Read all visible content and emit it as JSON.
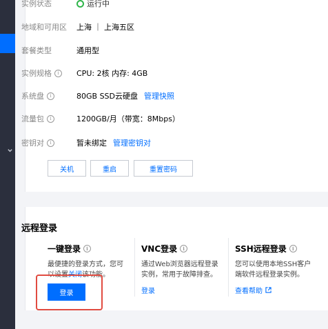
{
  "sidebar": {
    "active_color": "#006eff"
  },
  "instance": {
    "status_label": "实例状态",
    "status_value": "运行中",
    "region_label": "地域和可用区",
    "region_value": "上海 ｜ 上海五区",
    "plan_label": "套餐类型",
    "plan_value": "通用型",
    "spec_label": "实例规格",
    "spec_value": "CPU: 2核 内存: 4GB",
    "disk_label": "系统盘",
    "disk_value": "80GB SSD云硬盘",
    "disk_link": "管理快照",
    "traffic_label": "流量包",
    "traffic_value": "1200GB/月（带宽：8Mbps）",
    "key_label": "密钥对",
    "key_value": "暂未绑定",
    "key_link": "管理密钥对"
  },
  "actions": {
    "shutdown": "关机",
    "restart": "重启",
    "reset_password": "重置密码"
  },
  "remote": {
    "title": "远程登录",
    "one_click": {
      "title": "一键登录",
      "desc_line1": "最便捷的登录方式，您可",
      "desc_prefix": "以设置",
      "desc_link": "关闭",
      "desc_suffix": "该功能。",
      "button": "登录"
    },
    "vnc": {
      "title": "VNC登录",
      "desc_line1": "通过Web浏览器远程登录",
      "desc_line2": "实例，常用于故障排查。",
      "link": "登录"
    },
    "ssh": {
      "title": "SSH远程登录",
      "desc_line1": "您可以使用本地SSH客户",
      "desc_line2": "端软件远程登录实例。",
      "link": "查看帮助"
    }
  },
  "colors": {
    "accent": "#006eff",
    "running": "#2fb54a",
    "highlight": "#e14b40"
  }
}
